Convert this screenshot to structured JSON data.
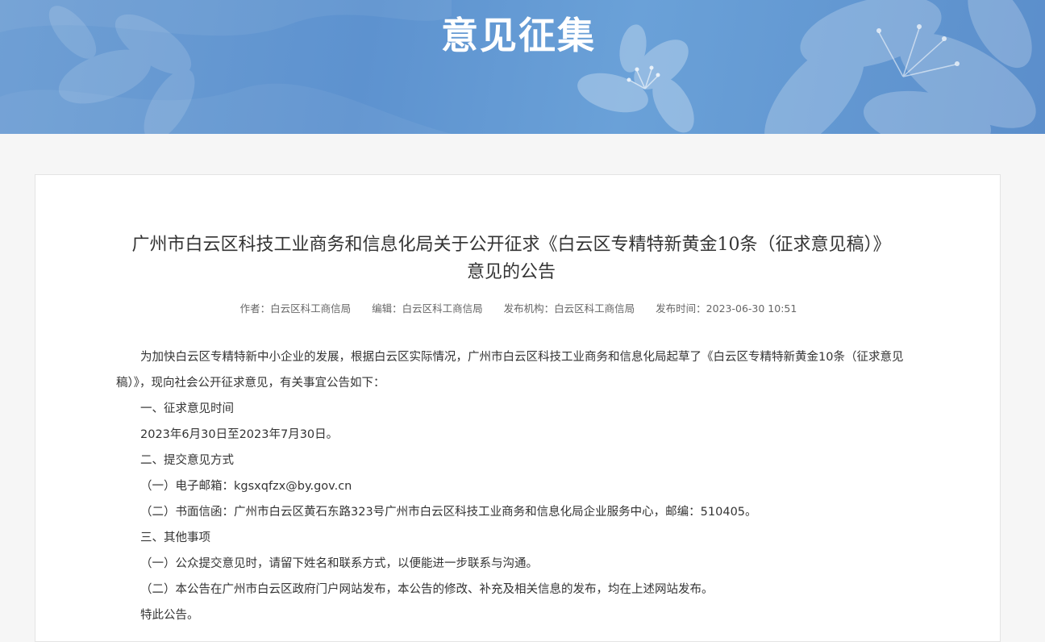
{
  "banner": {
    "title": "意见征集"
  },
  "article": {
    "title": "广州市白云区科技工业商务和信息化局关于公开征求《白云区专精特新黄金10条（征求意见稿）》意见的公告",
    "meta": {
      "author": "作者：白云区科工商信局",
      "editor": "编辑：白云区科工商信局",
      "publisher": "发布机构：白云区科工商信局",
      "time": "发布时间：2023-06-30 10:51"
    },
    "paragraphs": {
      "intro": "为加快白云区专精特新中小企业的发展，根据白云区实际情况，广州市白云区科技工业商务和信息化局起草了《白云区专精特新黄金10条（征求意见稿）》，现向社会公开征求意见，有关事宜公告如下：",
      "s1_heading": "一、征求意见时间",
      "s1_text": "2023年6月30日至2023年7月30日。",
      "s2_heading": "二、提交意见方式",
      "s2_item1": "（一）电子邮箱：kgsxqfzx@by.gov.cn",
      "s2_item2": "（二）书面信函：广州市白云区黄石东路323号广州市白云区科技工业商务和信息化局企业服务中心，邮编：510405。",
      "s3_heading": "三、其他事项",
      "s3_item1": "（一）公众提交意见时，请留下姓名和联系方式，以便能进一步联系与沟通。",
      "s3_item2": "（二）本公告在广州市白云区政府门户网站发布，本公告的修改、补充及相关信息的发布，均在上述网站发布。",
      "closing": "特此公告。"
    }
  },
  "colors": {
    "banner_blue": "#5d92cf",
    "text": "#333333",
    "meta_text": "#666666"
  }
}
